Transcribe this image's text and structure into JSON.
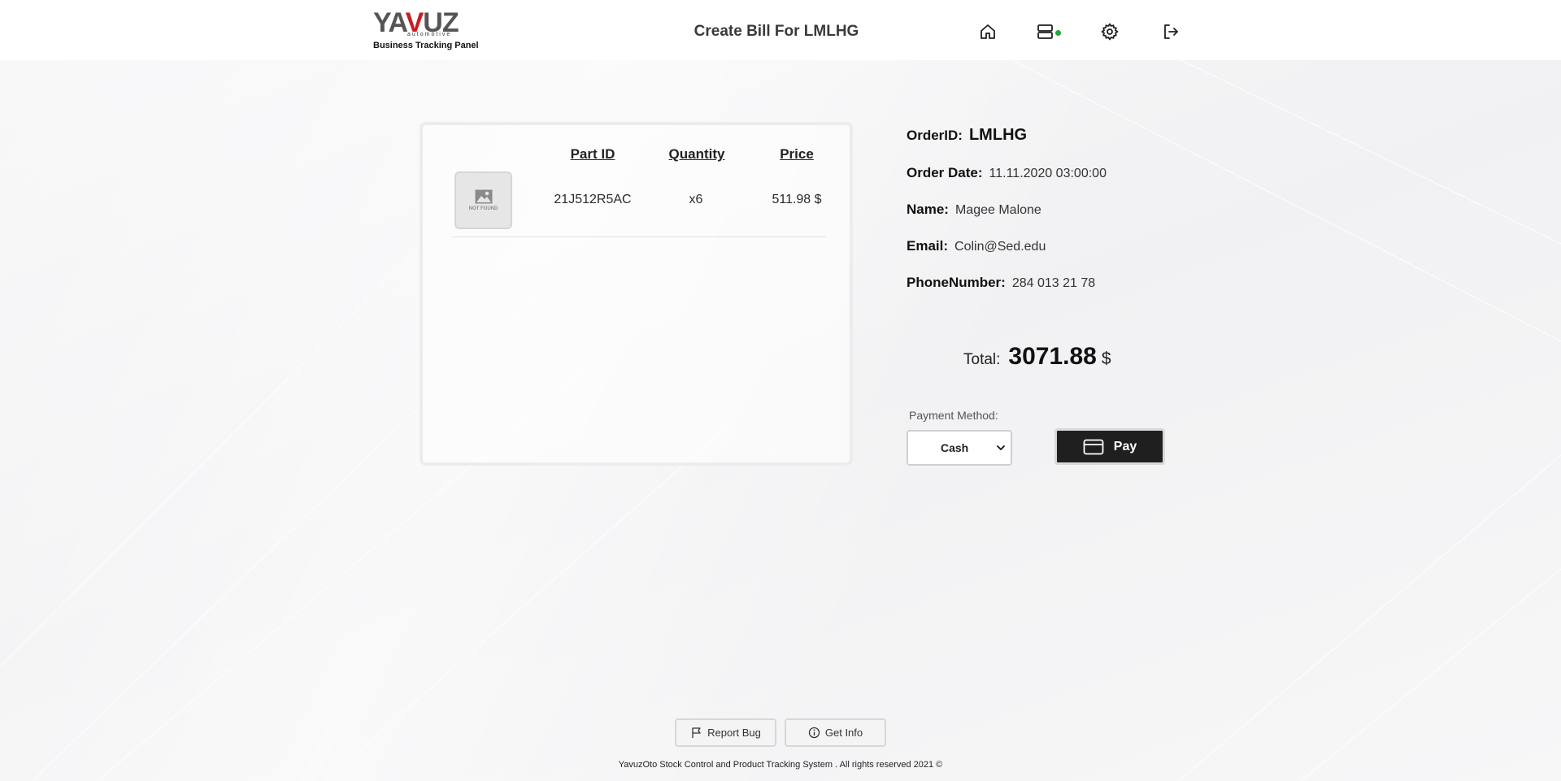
{
  "header": {
    "logo_text_left": "YA",
    "logo_text_accent": "V",
    "logo_text_right": "UZ",
    "logo_sub": "automotive",
    "panel_label": "Business Tracking Panel",
    "title": "Create Bill For LMLHG",
    "nav_icons": [
      "home-icon",
      "server-icon",
      "gear-icon",
      "logout-icon"
    ],
    "status_color": "#1ea83c"
  },
  "items": {
    "columns": [
      "Part ID",
      "Quantity",
      "Price"
    ],
    "rows": [
      {
        "image_text": "NOT FOUND",
        "part_id": "21J512R5AC",
        "quantity": "x6",
        "price": "511.98 $"
      }
    ]
  },
  "order": {
    "order_id_label": "OrderID:",
    "order_id": "LMLHG",
    "date_label": "Order Date:",
    "date": "11.11.2020 03:00:00",
    "name_label": "Name:",
    "name": "Magee Malone",
    "email_label": "Email:",
    "email": "Colin@Sed.edu",
    "phone_label": "PhoneNumber:",
    "phone": "284 013 21 78"
  },
  "total": {
    "label": "Total:",
    "value": "3071.88",
    "currency": "$"
  },
  "payment": {
    "label": "Payment Method:",
    "selected": "Cash",
    "pay_label": "Pay"
  },
  "footer": {
    "report_bug": "Report Bug",
    "get_info": "Get Info",
    "copyright": "YavuzOto Stock Control and Product Tracking System . All rights reserved 2021 ©"
  },
  "colors": {
    "accent": "#c71d24",
    "pay_button": "#1f1f1f"
  }
}
